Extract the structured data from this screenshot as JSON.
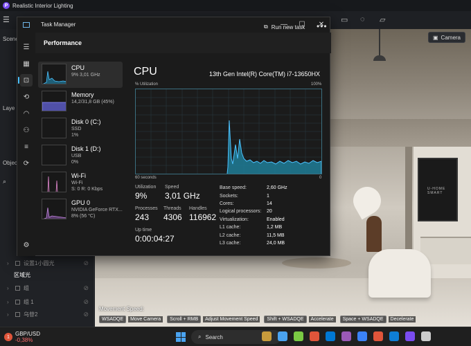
{
  "app": {
    "title": "Realistic Interior Lighting",
    "logo_letter": "P",
    "left_labels": [
      "Scene",
      "Laye",
      "Objec"
    ],
    "layers": [
      {
        "label": "设置1小圆光",
        "active": false
      },
      {
        "label": "区域光",
        "active": true
      },
      {
        "label": "组",
        "active": false
      },
      {
        "label": "组 1",
        "active": false
      },
      {
        "label": "乌苷2",
        "active": false
      }
    ],
    "camera_label": "Camera",
    "movement_speed_label": "Movement Speed:",
    "shortcuts": [
      {
        "key": "WSADQE",
        "desc": "Move Camera"
      },
      {
        "key": "Scroll + RMB",
        "desc": "Adjust Movement Speed"
      },
      {
        "key": "Shift + WSADQE",
        "desc": "Accelerate"
      },
      {
        "key": "Space + WSADQE",
        "desc": "Decelerate"
      }
    ],
    "tv_text": "U-HOME SMART"
  },
  "taskbar": {
    "ticker_name": "GBP/USD",
    "ticker_change": "-0,38%",
    "ticker_badge": "1",
    "search_placeholder": "Search",
    "app_colors": [
      "#c89b3c",
      "#4aa3f0",
      "#7ac943",
      "#e0553a",
      "#0078d4",
      "#9b59b6",
      "#3b82f6",
      "#e0553a",
      "#0e7ed6",
      "#7a4cf0",
      "#cccccc"
    ]
  },
  "task_manager": {
    "title": "Task Manager",
    "section_title": "Performance",
    "run_new_task": "Run new task",
    "more": "•••",
    "processes": [
      {
        "name": "CPU",
        "sub1": "9% 3,01 GHz",
        "sub2": "",
        "color": "#4cc2ff",
        "active": true
      },
      {
        "name": "Memory",
        "sub1": "14,2/31,8 GB (45%)",
        "sub2": "",
        "color": "#8c8cff",
        "active": false
      },
      {
        "name": "Disk 0 (C:)",
        "sub1": "SSD",
        "sub2": "1%",
        "color": "#4fd08a",
        "active": false
      },
      {
        "name": "Disk 1 (D:)",
        "sub1": "USB",
        "sub2": "0%",
        "color": "#4fd08a",
        "active": false
      },
      {
        "name": "Wi-Fi",
        "sub1": "Wi-Fi",
        "sub2": "S: 0 R: 0 Kbps",
        "color": "#e58ad2",
        "active": false
      },
      {
        "name": "GPU 0",
        "sub1": "NVIDIA GeForce RTX...",
        "sub2": "8% (56 °C)",
        "color": "#c48ae0",
        "active": false
      }
    ],
    "cpu": {
      "title": "CPU",
      "model": "13th Gen Intel(R) Core(TM) i7-13650HX",
      "util_label": "% Utilization",
      "util_max": "100%",
      "graph_left": "60 seconds",
      "graph_right": "0",
      "stats": {
        "utilization": {
          "label": "Utilization",
          "value": "9%"
        },
        "speed": {
          "label": "Speed",
          "value": "3,01 GHz"
        },
        "processes": {
          "label": "Processes",
          "value": "243"
        },
        "threads": {
          "label": "Threads",
          "value": "4306"
        },
        "handles": {
          "label": "Handles",
          "value": "116962"
        },
        "uptime": {
          "label": "Up time",
          "value": "0:00:04:27"
        }
      },
      "specs": [
        {
          "label": "Base speed:",
          "value": "2,60 GHz"
        },
        {
          "label": "Sockets:",
          "value": "1"
        },
        {
          "label": "Cores:",
          "value": "14"
        },
        {
          "label": "Logical processors:",
          "value": "20"
        },
        {
          "label": "Virtualization:",
          "value": "Enabled"
        },
        {
          "label": "L1 cache:",
          "value": "1,2 MB"
        },
        {
          "label": "L2 cache:",
          "value": "11,5 MB"
        },
        {
          "label": "L3 cache:",
          "value": "24,0 MB"
        }
      ]
    }
  }
}
